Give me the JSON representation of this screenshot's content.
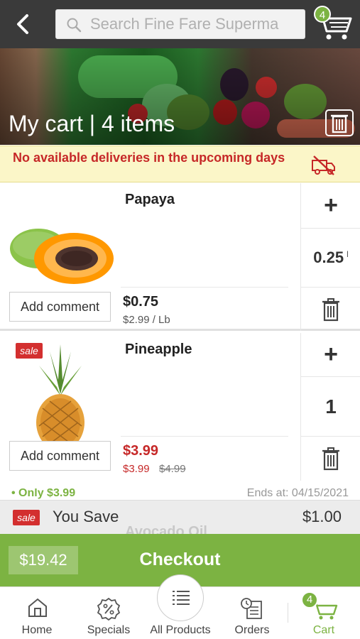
{
  "header": {
    "search_placeholder": "Search Fine Fare Superma",
    "cart_count": "4"
  },
  "hero": {
    "title": "My cart | 4 items"
  },
  "notice": {
    "text": "No available deliveries in the upcoming days"
  },
  "items": [
    {
      "name": "Papaya",
      "comment_label": "Add comment",
      "price": "$0.75",
      "unit_price": "$2.99 / Lb",
      "quantity": "0.25",
      "quantity_suffix": "l",
      "sale": false
    },
    {
      "name": "Pineapple",
      "comment_label": "Add comment",
      "sale_label": "sale",
      "price": "$3.99",
      "unit_price": "$3.99",
      "old_price": "$4.99",
      "quantity": "1",
      "sale": true
    }
  ],
  "promo": {
    "text": "• Only $3.99",
    "ends": "Ends at: 04/15/2021"
  },
  "next_item_name": "Avocado Oil",
  "savings": {
    "sale_label": "sale",
    "label": "You Save",
    "amount": "$1.00"
  },
  "checkout": {
    "total": "$19.42",
    "label": "Checkout"
  },
  "nav": {
    "home": "Home",
    "specials": "Specials",
    "all_products": "All Products",
    "orders": "Orders",
    "cart": "Cart",
    "cart_count": "4"
  },
  "colors": {
    "accent": "#7cb342",
    "topbar": "#3a3a3a",
    "sale": "#d32f2f",
    "notice_bg": "#fbf6c8"
  }
}
